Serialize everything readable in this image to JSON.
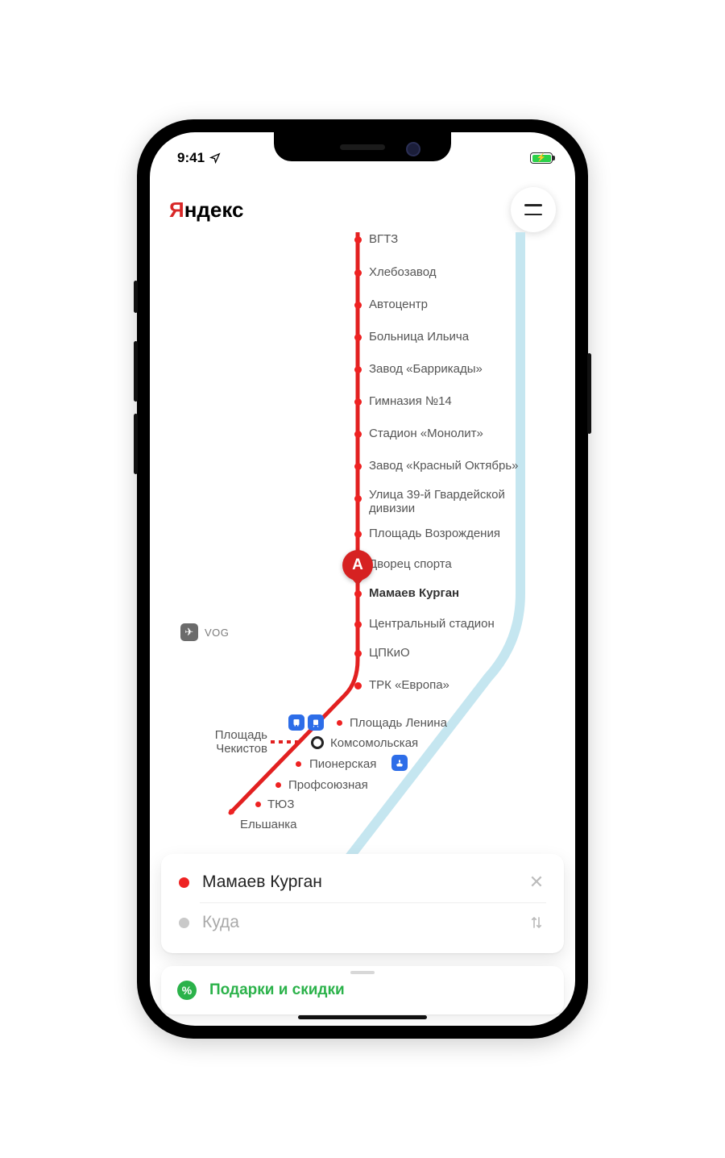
{
  "status": {
    "time": "9:41"
  },
  "brand": {
    "prefix": "Я",
    "suffix": "ндекс"
  },
  "airport": {
    "code": "VOG"
  },
  "marker": {
    "letter": "A"
  },
  "stations": {
    "vgtz": "ВГТЗ",
    "hlebozavod": "Хлебозавод",
    "avtocentr": "Автоцентр",
    "bolnica": "Больница Ильича",
    "barrikady": "Завод «Баррикады»",
    "gimnaziya": "Гимназия №14",
    "monolit": "Стадион «Монолит»",
    "oktyabr": "Завод «Красный Октябрь»",
    "ulica39_1": "Улица 39-й Гвардейской",
    "ulica39_2": "дивизии",
    "vozrozhdenie": "Площадь Возрождения",
    "dvorec": "Дворец спорта",
    "mamaev": "Мамаев Курган",
    "centralniy": "Центральный стадион",
    "cpkio": "ЦПКиО",
    "evropa": "ТРК «Европа»",
    "lenina": "Площадь Ленина",
    "komsomolskaya": "Комсомольская",
    "pionerskaya": "Пионерская",
    "profsoyuznaya": "Профсоюзная",
    "tyuz": "ТЮЗ",
    "elshanka": "Ельшанка",
    "chekistov_1": "Площадь",
    "chekistov_2": "Чекистов"
  },
  "route": {
    "from": "Мамаев Курган",
    "to_placeholder": "Куда"
  },
  "offers": {
    "label": "Подарки и скидки"
  }
}
